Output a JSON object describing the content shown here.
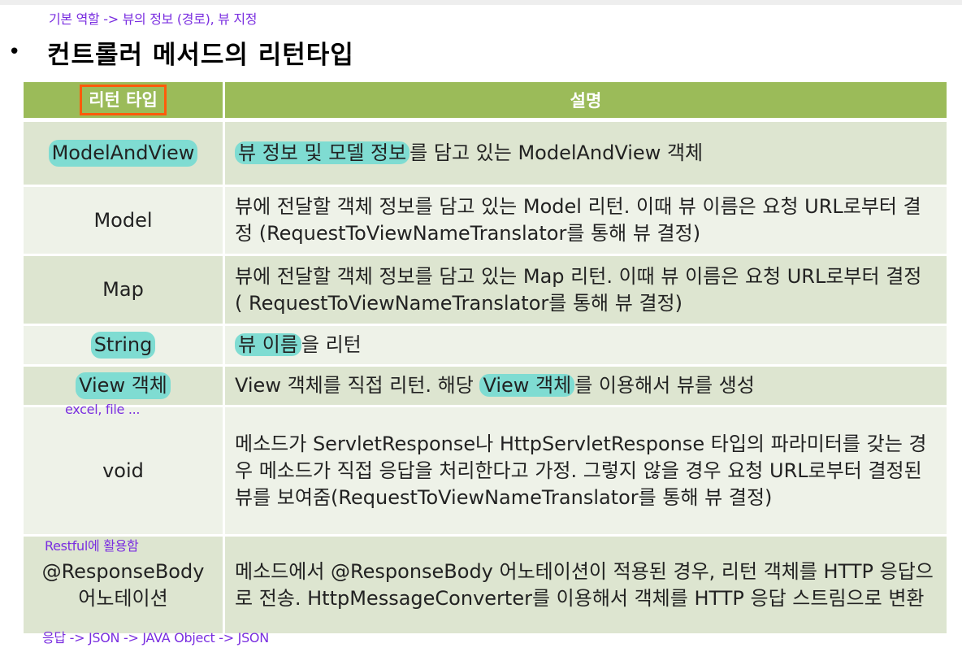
{
  "annotations": {
    "top_note": "기본 역할 -> 뷰의 정보 (경로), 뷰 지정",
    "view_object_note": "excel, file ...",
    "response_body_note": "Restful에 활용함",
    "bottom_note": "응답 -> JSON -> JAVA Object -> JSON"
  },
  "title": {
    "bullet": "•",
    "text": "컨트롤러 메서드의 리턴타입"
  },
  "table": {
    "header": {
      "col1": "리턴 타입",
      "col2": "설명"
    },
    "rows": [
      {
        "type": "ModelAndView",
        "desc_marked": "뷰 정보 및 모델 정보",
        "desc_rest": "를 담고 있는 ModelAndView 객체"
      },
      {
        "type": "Model",
        "desc": "뷰에 전달할 객체 정보를 담고 있는 Model 리턴. 이때 뷰 이름은 요청 URL로부터 결정 (RequestToViewNameTranslator를 통해 뷰 결정)"
      },
      {
        "type": "Map",
        "desc": "뷰에 전달할 객체 정보를 담고 있는 Map 리턴. 이때 뷰 이름은 요청 URL로부터 결정 ( RequestToViewNameTranslator를 통해 뷰 결정)"
      },
      {
        "type": "String",
        "desc_marked": "뷰 이름",
        "desc_rest": "을 리턴"
      },
      {
        "type": "View 객체",
        "desc_pre": "View 객체를 직접 리턴. 해당 ",
        "desc_marked": "View 객체",
        "desc_rest": "를 이용해서 뷰를 생성"
      },
      {
        "type": "void",
        "desc": "메소드가 ServletResponse나 HttpServletResponse 타입의 파라미터를 갖는 경우 메소드가 직접 응답을 처리한다고 가정. 그렇지 않을 경우 요청 URL로부터 결정된 뷰를 보여줌(RequestToViewNameTranslator를 통해 뷰 결정)"
      },
      {
        "type_line1": "@ResponseBody",
        "type_line2": "어노테이션",
        "desc": "메소드에서 @ResponseBody 어노테이션이 적용된 경우, 리턴 객체를 HTTP 응답으로 전송. HttpMessageConverter를 이용해서 객체를 HTTP 응답 스트림으로 변환"
      }
    ]
  },
  "colors": {
    "header_bg": "#9bbb59",
    "row_dark": "#dde5d0",
    "row_light": "#eef2e8",
    "highlight_marker": "#7fdcd2",
    "header_box_border": "#ff5a0a",
    "annotation_text": "#7a2ee0"
  }
}
